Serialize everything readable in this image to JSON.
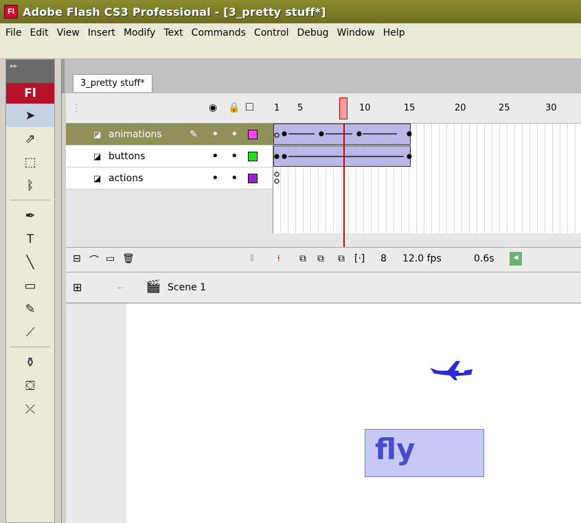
{
  "window": {
    "title": "Adobe Flash CS3 Professional - [3_pretty stuff*]",
    "app_icon": "Fl"
  },
  "menu": [
    "File",
    "Edit",
    "View",
    "Insert",
    "Modify",
    "Text",
    "Commands",
    "Control",
    "Debug",
    "Window",
    "Help"
  ],
  "tools": {
    "logo": "Fl",
    "items": [
      {
        "name": "selection-tool-icon",
        "glyph": "➤",
        "selected": true
      },
      {
        "name": "subselection-tool-icon",
        "glyph": "⇗"
      },
      {
        "name": "free-transform-tool-icon",
        "glyph": "⬚"
      },
      {
        "name": "lasso-tool-icon",
        "glyph": "ᛔ"
      },
      {
        "name": "pen-tool-icon",
        "glyph": "✒"
      },
      {
        "name": "text-tool-icon",
        "glyph": "T"
      },
      {
        "name": "line-tool-icon",
        "glyph": "╲"
      },
      {
        "name": "rectangle-tool-icon",
        "glyph": "▭"
      },
      {
        "name": "pencil-tool-icon",
        "glyph": "✎"
      },
      {
        "name": "brush-tool-icon",
        "glyph": "⟋"
      },
      {
        "name": "ink-bottle-tool-icon",
        "glyph": "⚱"
      },
      {
        "name": "paint-bucket-tool-icon",
        "glyph": "⛋"
      },
      {
        "name": "eyedropper-tool-icon",
        "glyph": "⤫"
      }
    ]
  },
  "document": {
    "tab": "3_pretty stuff*"
  },
  "timeline": {
    "ruler": [
      "1",
      "5",
      "10",
      "15",
      "20",
      "25",
      "30"
    ],
    "current_frame": 8,
    "layers": [
      {
        "name": "animations",
        "color": "#ff44ff",
        "active": true
      },
      {
        "name": "buttons",
        "color": "#22dd22",
        "active": false
      },
      {
        "name": "actions",
        "color": "#9922cc",
        "active": false
      }
    ],
    "footer": {
      "frame": "8",
      "fps": "12.0 fps",
      "time": "0.6s"
    }
  },
  "editbar": {
    "scene": "Scene 1"
  },
  "stage": {
    "button_label": "fly"
  }
}
